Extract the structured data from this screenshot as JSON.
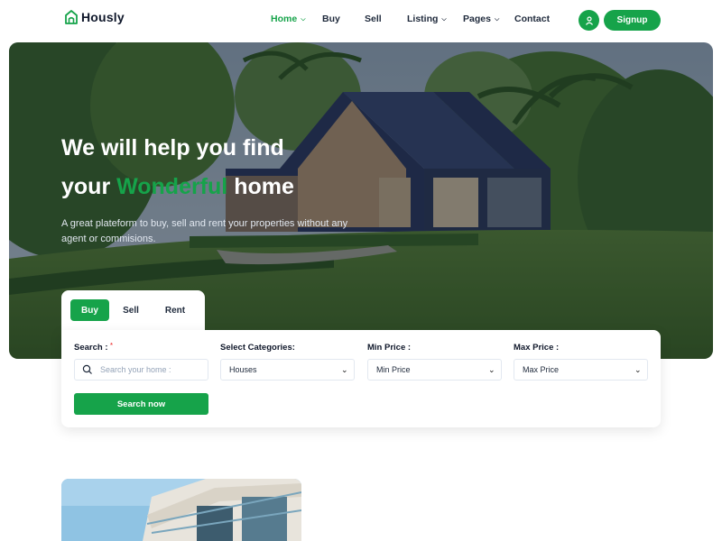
{
  "brand": {
    "name": "Hously",
    "logo_icon": "house-outline-icon",
    "accent": "#16a34a"
  },
  "nav": {
    "items": [
      {
        "label": "Home",
        "has_dropdown": true,
        "active": true
      },
      {
        "label": "Buy",
        "has_dropdown": false
      },
      {
        "label": "Sell",
        "has_dropdown": false
      },
      {
        "label": "Listing",
        "has_dropdown": true
      },
      {
        "label": "Pages",
        "has_dropdown": true
      },
      {
        "label": "Contact",
        "has_dropdown": false
      }
    ],
    "user_icon": "user-icon",
    "signup_label": "Signup"
  },
  "hero": {
    "title_line1": "We will help you find",
    "title_prefix": "your ",
    "title_highlight": "Wonderful",
    "title_suffix": " home",
    "subtitle": "A great plateform to buy, sell and rent your properties without any agent or commisions."
  },
  "tabs": [
    {
      "label": "Buy",
      "active": true
    },
    {
      "label": "Sell",
      "active": false
    },
    {
      "label": "Rent",
      "active": false
    }
  ],
  "search": {
    "search_label": "Search :",
    "required_mark": "*",
    "search_placeholder": "Search your home :",
    "category_label": "Select Categories:",
    "category_value": "Houses",
    "min_label": "Min Price :",
    "min_value": "Min Price",
    "max_label": "Max Price :",
    "max_value": "Max Price",
    "submit_label": "Search now"
  }
}
